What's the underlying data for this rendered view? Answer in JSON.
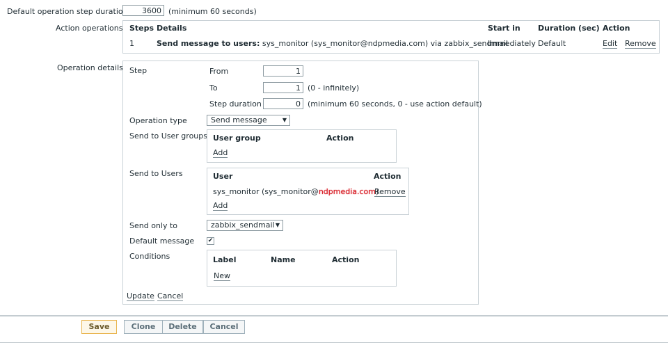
{
  "step_duration": {
    "label": "Default operation step duration",
    "value": "3600",
    "hint": "(minimum 60 seconds)"
  },
  "action_operations": {
    "label": "Action operations",
    "headers": {
      "steps": "Steps",
      "details": "Details",
      "start_in": "Start in",
      "duration": "Duration (sec)",
      "action": "Action"
    },
    "row": {
      "steps": "1",
      "details_bold": "Send message to users:",
      "details_rest": "sys_monitor (sys_monitor@ndpmedia.com) via zabbix_sendmail",
      "start_in": "Immediately",
      "duration": "Default",
      "edit": "Edit",
      "remove": "Remove"
    }
  },
  "operation_details": {
    "label": "Operation details",
    "step_label": "Step",
    "from_label": "From",
    "from_value": "1",
    "to_label": "To",
    "to_value": "1",
    "to_hint": "(0 - infinitely)",
    "step_duration_label": "Step duration",
    "step_duration_value": "0",
    "step_duration_hint": "(minimum 60 seconds, 0 - use action default)",
    "operation_type_label": "Operation type",
    "operation_type_value": "Send message",
    "user_groups": {
      "label": "Send to User groups",
      "col_group": "User group",
      "col_action": "Action",
      "add": "Add"
    },
    "users": {
      "label": "Send to Users",
      "col_user": "User",
      "col_action": "Action",
      "user_prefix": "sys_monitor (sys_monitor@",
      "user_redacted": "ndpmedia.com",
      "user_suffix": ")",
      "remove": "Remove",
      "add": "Add"
    },
    "send_only_label": "Send only to",
    "send_only_value": "zabbix_sendmail",
    "default_message_label": "Default message",
    "default_message_checked": "✔",
    "conditions": {
      "label": "Conditions",
      "col_label": "Label",
      "col_name": "Name",
      "col_action": "Action",
      "new": "New"
    },
    "update": "Update",
    "cancel": "Cancel"
  },
  "footer": {
    "save": "Save",
    "clone": "Clone",
    "delete": "Delete",
    "cancel": "Cancel"
  }
}
